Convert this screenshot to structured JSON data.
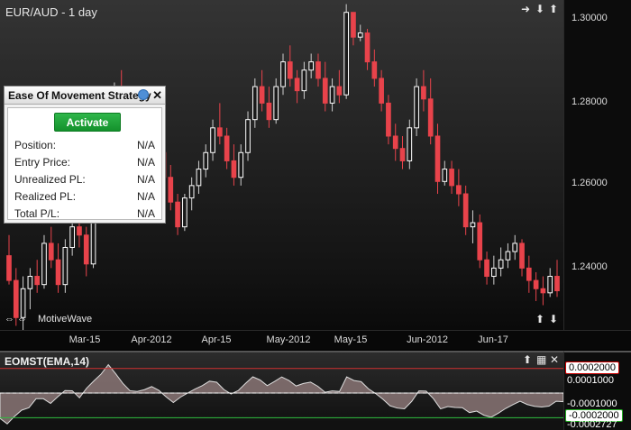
{
  "chart": {
    "title": "EUR/AUD - 1 day",
    "watermark": "MotiveWave",
    "price_ticks": [
      "1.30000",
      "1.28000",
      "1.26000",
      "1.24000"
    ],
    "date_ticks": [
      "Mar-15",
      "Apr-2012",
      "Apr-15",
      "May-2012",
      "May-15",
      "Jun-2012",
      "Jun-17"
    ]
  },
  "chart_data": {
    "type": "candlestick",
    "instrument": "EUR/AUD",
    "interval": "1 day",
    "ylim": [
      1.225,
      1.305
    ],
    "candles": [
      [
        1.243,
        1.248,
        1.236,
        1.237
      ],
      [
        1.237,
        1.24,
        1.226,
        1.228
      ],
      [
        1.228,
        1.238,
        1.225,
        1.235
      ],
      [
        1.235,
        1.24,
        1.23,
        1.238
      ],
      [
        1.238,
        1.242,
        1.234,
        1.236
      ],
      [
        1.236,
        1.248,
        1.235,
        1.246
      ],
      [
        1.246,
        1.25,
        1.24,
        1.242
      ],
      [
        1.242,
        1.246,
        1.234,
        1.236
      ],
      [
        1.236,
        1.247,
        1.234,
        1.245
      ],
      [
        1.245,
        1.252,
        1.243,
        1.25
      ],
      [
        1.25,
        1.256,
        1.245,
        1.248
      ],
      [
        1.248,
        1.25,
        1.238,
        1.241
      ],
      [
        1.241,
        1.256,
        1.24,
        1.254
      ],
      [
        1.254,
        1.263,
        1.252,
        1.261
      ],
      [
        1.261,
        1.272,
        1.259,
        1.27
      ],
      [
        1.27,
        1.285,
        1.268,
        1.283
      ],
      [
        1.283,
        1.288,
        1.27,
        1.272
      ],
      [
        1.272,
        1.276,
        1.264,
        1.266
      ],
      [
        1.266,
        1.269,
        1.258,
        1.26
      ],
      [
        1.26,
        1.264,
        1.256,
        1.262
      ],
      [
        1.262,
        1.266,
        1.258,
        1.264
      ],
      [
        1.264,
        1.27,
        1.26,
        1.268
      ],
      [
        1.268,
        1.272,
        1.26,
        1.262
      ],
      [
        1.262,
        1.265,
        1.254,
        1.256
      ],
      [
        1.256,
        1.258,
        1.248,
        1.25
      ],
      [
        1.25,
        1.258,
        1.249,
        1.257
      ],
      [
        1.257,
        1.262,
        1.254,
        1.26
      ],
      [
        1.26,
        1.266,
        1.258,
        1.264
      ],
      [
        1.264,
        1.27,
        1.262,
        1.268
      ],
      [
        1.268,
        1.276,
        1.266,
        1.274
      ],
      [
        1.274,
        1.28,
        1.27,
        1.272
      ],
      [
        1.272,
        1.274,
        1.264,
        1.266
      ],
      [
        1.266,
        1.27,
        1.26,
        1.262
      ],
      [
        1.262,
        1.27,
        1.26,
        1.268
      ],
      [
        1.268,
        1.278,
        1.266,
        1.276
      ],
      [
        1.276,
        1.286,
        1.274,
        1.284
      ],
      [
        1.284,
        1.288,
        1.278,
        1.28
      ],
      [
        1.28,
        1.284,
        1.274,
        1.276
      ],
      [
        1.276,
        1.286,
        1.275,
        1.284
      ],
      [
        1.284,
        1.292,
        1.282,
        1.29
      ],
      [
        1.29,
        1.294,
        1.284,
        1.286
      ],
      [
        1.286,
        1.288,
        1.28,
        1.283
      ],
      [
        1.283,
        1.29,
        1.281,
        1.288
      ],
      [
        1.288,
        1.292,
        1.286,
        1.29
      ],
      [
        1.29,
        1.292,
        1.284,
        1.286
      ],
      [
        1.286,
        1.29,
        1.278,
        1.28
      ],
      [
        1.28,
        1.286,
        1.278,
        1.284
      ],
      [
        1.284,
        1.288,
        1.28,
        1.282
      ],
      [
        1.282,
        1.304,
        1.281,
        1.302
      ],
      [
        1.302,
        1.3,
        1.294,
        1.296
      ],
      [
        1.296,
        1.299,
        1.295,
        1.297
      ],
      [
        1.297,
        1.298,
        1.288,
        1.29
      ],
      [
        1.29,
        1.293,
        1.284,
        1.286
      ],
      [
        1.286,
        1.288,
        1.278,
        1.28
      ],
      [
        1.28,
        1.282,
        1.27,
        1.272
      ],
      [
        1.272,
        1.275,
        1.266,
        1.269
      ],
      [
        1.269,
        1.272,
        1.264,
        1.266
      ],
      [
        1.266,
        1.276,
        1.264,
        1.274
      ],
      [
        1.274,
        1.286,
        1.272,
        1.284
      ],
      [
        1.284,
        1.288,
        1.278,
        1.281
      ],
      [
        1.281,
        1.286,
        1.27,
        1.272
      ],
      [
        1.272,
        1.275,
        1.258,
        1.261
      ],
      [
        1.261,
        1.266,
        1.26,
        1.264
      ],
      [
        1.264,
        1.266,
        1.258,
        1.26
      ],
      [
        1.26,
        1.264,
        1.255,
        1.258
      ],
      [
        1.258,
        1.26,
        1.248,
        1.25
      ],
      [
        1.25,
        1.254,
        1.246,
        1.251
      ],
      [
        1.251,
        1.253,
        1.24,
        1.242
      ],
      [
        1.242,
        1.244,
        1.236,
        1.238
      ],
      [
        1.238,
        1.243,
        1.236,
        1.24
      ],
      [
        1.24,
        1.245,
        1.238,
        1.242
      ],
      [
        1.242,
        1.246,
        1.24,
        1.244
      ],
      [
        1.244,
        1.248,
        1.242,
        1.246
      ],
      [
        1.246,
        1.247,
        1.238,
        1.24
      ],
      [
        1.24,
        1.243,
        1.234,
        1.237
      ],
      [
        1.237,
        1.239,
        1.232,
        1.235
      ],
      [
        1.235,
        1.238,
        1.231,
        1.234
      ],
      [
        1.234,
        1.24,
        1.233,
        1.238
      ],
      [
        1.238,
        1.242,
        1.233,
        1.2345
      ]
    ],
    "indicator": {
      "name": "EOMST(EMA,14)",
      "levels": {
        "upper": 0.0002,
        "zero": 0.0,
        "lower": -0.0002
      },
      "markers": [
        "0.0002000",
        "0.0001000",
        "-0.0001000",
        "-0.0002000",
        "-0.0002727"
      ]
    }
  },
  "strategy": {
    "title": "Ease Of Movement Strategy",
    "activate_label": "Activate",
    "rows": [
      {
        "label": "Position:",
        "value": "N/A"
      },
      {
        "label": "Entry Price:",
        "value": "N/A"
      },
      {
        "label": "Unrealized PL:",
        "value": "N/A"
      },
      {
        "label": "Realized PL:",
        "value": "N/A"
      },
      {
        "label": "Total P/L:",
        "value": "N/A"
      }
    ]
  },
  "colors": {
    "up_candle": "#ffffff",
    "down_candle": "#e8434b",
    "upper_line": "#d03030",
    "lower_line": "#30c040"
  }
}
